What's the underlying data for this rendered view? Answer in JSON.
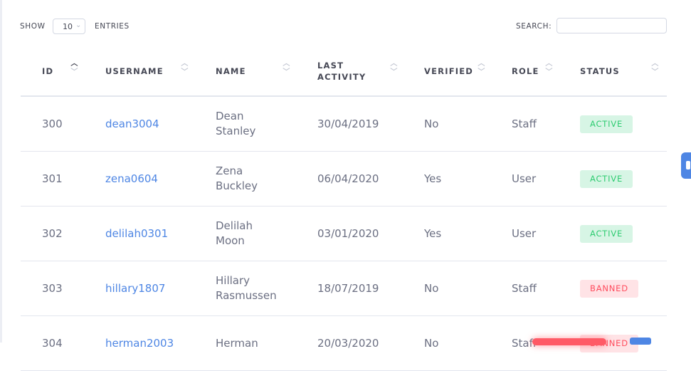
{
  "controls": {
    "show_label": "SHOW",
    "page_size": "10",
    "entries_label": "ENTRIES",
    "search_label": "SEARCH:",
    "search_value": ""
  },
  "columns": [
    {
      "label": "ID",
      "sort": "asc"
    },
    {
      "label": "USERNAME",
      "sort": "none"
    },
    {
      "label": "NAME",
      "sort": "none"
    },
    {
      "label": "LAST ACTIVITY",
      "label_line1": "LAST",
      "label_line2": "ACTIVITY",
      "sort": "none"
    },
    {
      "label": "VERIFIED",
      "sort": "none"
    },
    {
      "label": "ROLE",
      "sort": "none"
    },
    {
      "label": "STATUS",
      "sort": "none"
    }
  ],
  "rows": [
    {
      "id": "300",
      "username": "dean3004",
      "first": "Dean",
      "last": "Stanley",
      "activity": "30/04/2019",
      "verified": "No",
      "role": "Staff",
      "status": "ACTIVE"
    },
    {
      "id": "301",
      "username": "zena0604",
      "first": "Zena",
      "last": "Buckley",
      "activity": "06/04/2020",
      "verified": "Yes",
      "role": "User",
      "status": "ACTIVE"
    },
    {
      "id": "302",
      "username": "delilah0301",
      "first": "Delilah",
      "last": "Moon",
      "activity": "03/01/2020",
      "verified": "Yes",
      "role": "User",
      "status": "ACTIVE"
    },
    {
      "id": "303",
      "username": "hillary1807",
      "first": "Hillary",
      "last": "Rasmussen",
      "activity": "18/07/2019",
      "verified": "No",
      "role": "Staff",
      "status": "BANNED"
    },
    {
      "id": "304",
      "username": "herman2003",
      "first": "Herman",
      "last": "",
      "activity": "20/03/2020",
      "verified": "No",
      "role": "Staff",
      "status": "BANNED"
    }
  ],
  "colors": {
    "link": "#4e86e4",
    "active_badge_bg": "#d7f5e5",
    "active_badge_text": "#2ecc71",
    "banned_badge_bg": "#ffe3e6",
    "banned_badge_text": "#ff4d5e"
  }
}
